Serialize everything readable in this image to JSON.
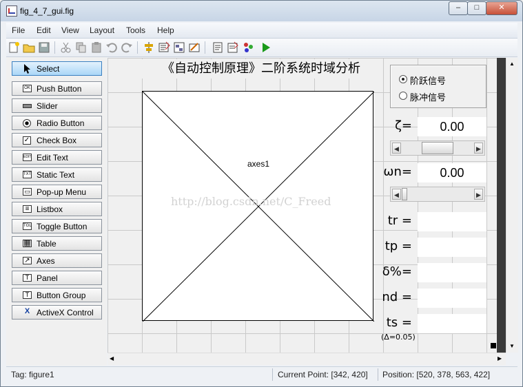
{
  "window": {
    "title": "fig_4_7_gui.fig"
  },
  "menu": [
    "File",
    "Edit",
    "View",
    "Layout",
    "Tools",
    "Help"
  ],
  "palette": [
    {
      "label": "Select",
      "icon": "pointer-icon",
      "selected": true
    },
    {
      "label": "Push Button",
      "icon": "push-button-icon",
      "glyph": "OK"
    },
    {
      "label": "Slider",
      "icon": "slider-icon",
      "glyph": ""
    },
    {
      "label": "Radio Button",
      "icon": "radio-button-icon",
      "glyph": ""
    },
    {
      "label": "Check Box",
      "icon": "check-box-icon",
      "glyph": "✓"
    },
    {
      "label": "Edit Text",
      "icon": "edit-text-icon",
      "glyph": "EDIT"
    },
    {
      "label": "Static Text",
      "icon": "static-text-icon",
      "glyph": "TXT"
    },
    {
      "label": "Pop-up Menu",
      "icon": "popup-menu-icon",
      "glyph": "▭"
    },
    {
      "label": "Listbox",
      "icon": "listbox-icon",
      "glyph": "≡"
    },
    {
      "label": "Toggle Button",
      "icon": "toggle-button-icon",
      "glyph": "TGL"
    },
    {
      "label": "Table",
      "icon": "table-icon",
      "glyph": "▦"
    },
    {
      "label": "Axes",
      "icon": "axes-icon",
      "glyph": "↗"
    },
    {
      "label": "Panel",
      "icon": "panel-icon",
      "glyph": "T"
    },
    {
      "label": "Button Group",
      "icon": "button-group-icon",
      "glyph": "T"
    },
    {
      "label": "ActiveX Control",
      "icon": "activex-icon",
      "glyph": "X"
    }
  ],
  "canvas": {
    "gui_title": "《自动控制原理》二阶系统时域分析",
    "axes_label": "axes1",
    "watermark": "http://blog.csdn.net/C_Freed",
    "radio_options": [
      {
        "label": "阶跃信号",
        "checked": true
      },
      {
        "label": "脉冲信号",
        "checked": false
      }
    ],
    "zeta": {
      "label": "ζ=",
      "value": "0.00",
      "slider_level": 0.5
    },
    "omega": {
      "label": "ωn=",
      "value": "0.00",
      "slider_level": 0.0
    },
    "metrics": [
      {
        "label": "tr =",
        "value": ""
      },
      {
        "label": "tp =",
        "value": ""
      },
      {
        "label": "δ%=",
        "value": ""
      },
      {
        "label": "nd =",
        "value": ""
      },
      {
        "label": "ts =",
        "value": ""
      }
    ],
    "ts_note": "(Δ=0.05)"
  },
  "status": {
    "tag": "Tag: figure1",
    "current_point": "Current Point:  [342, 420]",
    "position": "Position: [520, 378, 563, 422]"
  }
}
